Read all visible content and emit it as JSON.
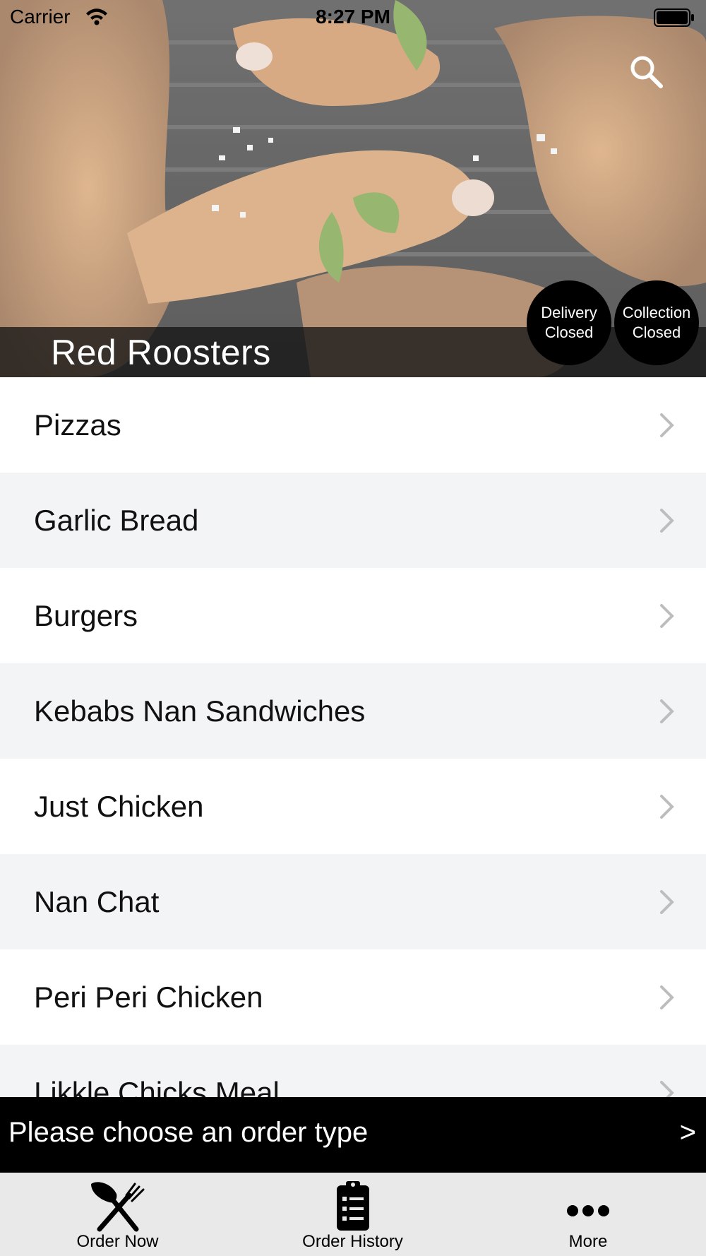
{
  "status_bar": {
    "carrier": "Carrier",
    "time": "8:27 PM"
  },
  "hero": {
    "restaurant_name": "Red Roosters",
    "delivery_badge": {
      "line1": "Delivery",
      "line2": "Closed"
    },
    "collection_badge": {
      "line1": "Collection",
      "line2": "Closed"
    }
  },
  "menu": {
    "categories": [
      {
        "label": "Pizzas"
      },
      {
        "label": "Garlic Bread"
      },
      {
        "label": "Burgers"
      },
      {
        "label": "Kebabs Nan Sandwiches"
      },
      {
        "label": "Just Chicken"
      },
      {
        "label": "Nan Chat"
      },
      {
        "label": "Peri Peri Chicken"
      },
      {
        "label": "Likkle Chicks Meal"
      }
    ]
  },
  "order_bar": {
    "prompt": "Please choose an order type",
    "arrow": ">"
  },
  "tabs": [
    {
      "label": "Order Now",
      "icon": "fork-knife-icon"
    },
    {
      "label": "Order History",
      "icon": "clipboard-icon"
    },
    {
      "label": "More",
      "icon": "more-dots-icon"
    }
  ]
}
